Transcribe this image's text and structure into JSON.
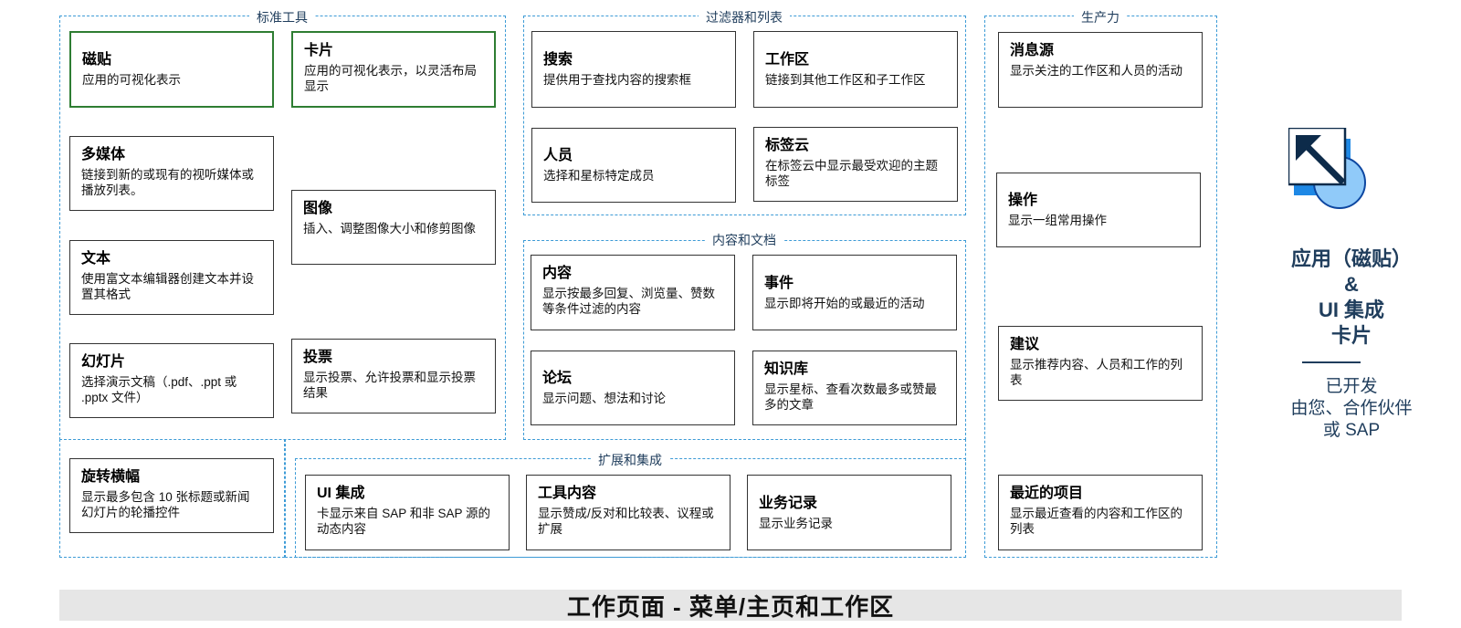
{
  "groups": {
    "standard": "标准工具",
    "filters": "过滤器和列表",
    "productivity": "生产力",
    "content_docs": "内容和文档",
    "extension": "扩展和集成"
  },
  "cards": {
    "tile": {
      "title": "磁贴",
      "desc": "应用的可视化表示"
    },
    "card": {
      "title": "卡片",
      "desc": "应用的可视化表示，以灵活布局显示"
    },
    "multimedia": {
      "title": "多媒体",
      "desc": "链接到新的或现有的视听媒体或播放列表。"
    },
    "image": {
      "title": "图像",
      "desc": "插入、调整图像大小和修剪图像"
    },
    "text": {
      "title": "文本",
      "desc": "使用富文本编辑器创建文本并设置其格式"
    },
    "slides": {
      "title": "幻灯片",
      "desc": "选择演示文稿（.pdf、.ppt 或 .pptx 文件）"
    },
    "poll": {
      "title": "投票",
      "desc": "显示投票、允许投票和显示投票结果"
    },
    "carousel": {
      "title": "旋转横幅",
      "desc": "显示最多包含 10 张标题或新闻幻灯片的轮播控件"
    },
    "search": {
      "title": "搜索",
      "desc": "提供用于查找内容的搜索框"
    },
    "workspace": {
      "title": "工作区",
      "desc": "链接到其他工作区和子工作区"
    },
    "people": {
      "title": "人员",
      "desc": "选择和星标特定成员"
    },
    "tagcloud": {
      "title": "标签云",
      "desc": "在标签云中显示最受欢迎的主题标签"
    },
    "content": {
      "title": "内容",
      "desc": "显示按最多回复、浏览量、赞数等条件过滤的内容"
    },
    "events": {
      "title": "事件",
      "desc": "显示即将开始的或最近的活动"
    },
    "forum": {
      "title": "论坛",
      "desc": "显示问题、想法和讨论"
    },
    "kb": {
      "title": "知识库",
      "desc": "显示星标、查看次数最多或赞最多的文章"
    },
    "ui_integration": {
      "title": "UI 集成",
      "desc": "卡显示来自 SAP 和非 SAP 源的动态内容"
    },
    "tool_content": {
      "title": "工具内容",
      "desc": "显示赞成/反对和比较表、议程或扩展"
    },
    "business_record": {
      "title": "业务记录",
      "desc": "显示业务记录"
    },
    "feed": {
      "title": "消息源",
      "desc": "显示关注的工作区和人员的活动"
    },
    "actions": {
      "title": "操作",
      "desc": "显示一组常用操作"
    },
    "recommend": {
      "title": "建议",
      "desc": "显示推荐内容、人员和工作的列表"
    },
    "recent": {
      "title": "最近的项目",
      "desc": "显示最近查看的内容和工作区的列表"
    }
  },
  "side": {
    "title_lines": [
      "应用（磁贴）",
      "&",
      "UI 集成",
      "卡片"
    ],
    "sub_lines": [
      "已开发",
      "由您、合作伙伴",
      "或 SAP"
    ]
  },
  "footer": "工作页面 - 菜单/主页和工作区",
  "colors": {
    "group_border": "#3d9bd6",
    "highlight_border": "#2e7d32",
    "accent": "#1f3d5c",
    "footer_bg": "#e6e6e6"
  },
  "icons": {
    "logo": "arrow-up-left-tile-icon"
  }
}
